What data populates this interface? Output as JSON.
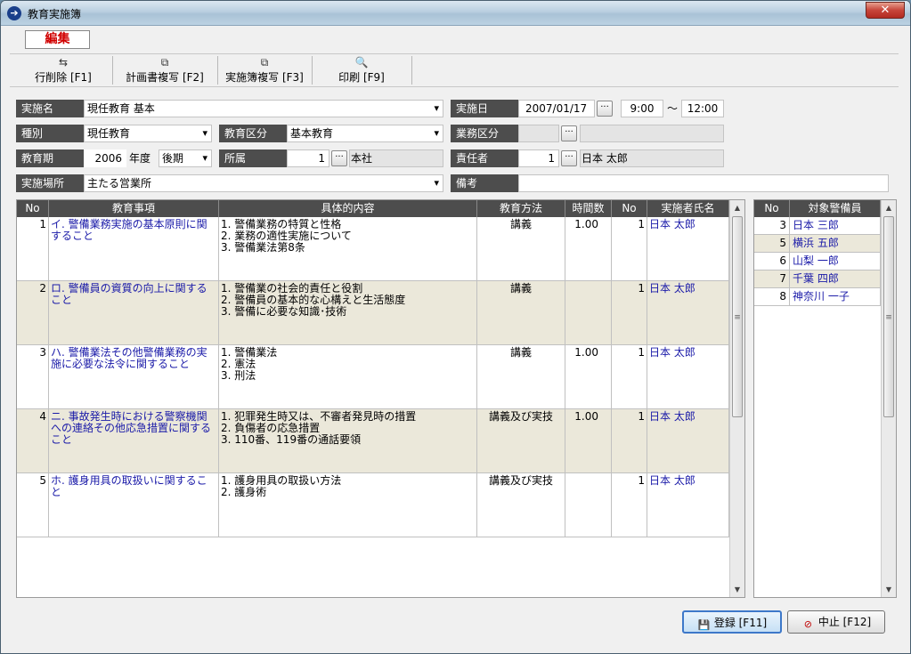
{
  "window": {
    "title": "教育実施簿",
    "close_symbol": "✕"
  },
  "mode_label": "編集",
  "toolbar": {
    "delete_row": "行削除 [F1]",
    "copy_plan": "計画書複写 [F2]",
    "copy_record": "実施簿複写 [F3]",
    "print": "印刷 [F9]"
  },
  "form": {
    "name_label": "実施名",
    "name_value": "現任教育 基本",
    "date_label": "実施日",
    "date_value": "2007/01/17",
    "time_start": "9:00",
    "time_sep": "〜",
    "time_end": "12:00",
    "kind_label": "種別",
    "kind_value": "現任教育",
    "edu_cat_label": "教育区分",
    "edu_cat_value": "基本教育",
    "work_cat_label": "業務区分",
    "work_cat_value": "",
    "work_cat_name": "",
    "period_label": "教育期",
    "period_year": "2006",
    "period_year_suffix": "年度",
    "period_term": "後期",
    "dept_label": "所属",
    "dept_code": "1",
    "dept_name": "本社",
    "manager_label": "責任者",
    "manager_code": "1",
    "manager_name": "日本 太郎",
    "place_label": "実施場所",
    "place_value": "主たる営業所",
    "remarks_label": "備考",
    "remarks_value": ""
  },
  "grid": {
    "headers": [
      "No",
      "教育事項",
      "具体的内容",
      "教育方法",
      "時間数",
      "No",
      "実施者氏名"
    ],
    "rows": [
      {
        "no": "1",
        "item": "イ. 警備業務実施の基本原則に関すること",
        "contents": [
          "1. 警備業務の特質と性格",
          "2. 業務の適性実施について",
          "3. 警備業法第8条"
        ],
        "method": "講義",
        "hours": "1.00",
        "instructor_no": "1",
        "instructor": "日本 太郎"
      },
      {
        "no": "2",
        "item": "ロ. 警備員の資質の向上に関すること",
        "contents": [
          "1. 警備業の社会的責任と役割",
          "2. 警備員の基本的な心構えと生活態度",
          "3. 警備に必要な知識･技術"
        ],
        "method": "講義",
        "hours": "",
        "instructor_no": "1",
        "instructor": "日本 太郎"
      },
      {
        "no": "3",
        "item": "ハ. 警備業法その他警備業務の実施に必要な法令に関すること",
        "contents": [
          "1. 警備業法",
          "2. 憲法",
          "3. 刑法"
        ],
        "method": "講義",
        "hours": "1.00",
        "instructor_no": "1",
        "instructor": "日本 太郎"
      },
      {
        "no": "4",
        "item": "ニ. 事故発生時における警察機関への連絡その他応急措置に関すること",
        "contents": [
          "1. 犯罪発生時又は、不審者発見時の措置",
          "2. 負傷者の応急措置",
          "3. 110番、119番の通話要領"
        ],
        "method": "講義及び実技",
        "hours": "1.00",
        "instructor_no": "1",
        "instructor": "日本 太郎"
      },
      {
        "no": "5",
        "item": "ホ. 護身用具の取扱いに関すること",
        "contents": [
          "1. 護身用具の取扱い方法",
          "2. 護身術"
        ],
        "method": "講義及び実技",
        "hours": "",
        "instructor_no": "1",
        "instructor": "日本 太郎"
      }
    ]
  },
  "guards": {
    "headers": [
      "No",
      "対象警備員"
    ],
    "rows": [
      {
        "no": "3",
        "name": "日本 三郎"
      },
      {
        "no": "5",
        "name": "横浜 五郎"
      },
      {
        "no": "6",
        "name": "山梨 一郎"
      },
      {
        "no": "7",
        "name": "千葉 四郎"
      },
      {
        "no": "8",
        "name": "神奈川 一子"
      }
    ]
  },
  "buttons": {
    "register": "登録 [F11]",
    "cancel": "中止 [F12]"
  }
}
